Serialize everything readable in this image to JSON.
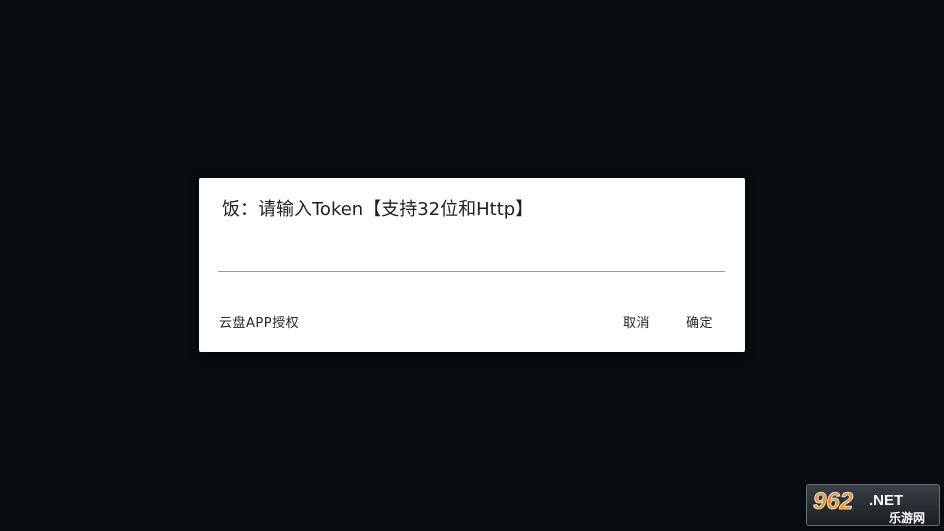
{
  "dialog": {
    "title": "饭：请输入Token【支持32位和Http】",
    "input": {
      "value": "",
      "placeholder": ""
    },
    "buttons": {
      "auth_label": "云盘APP授权",
      "cancel_label": "取消",
      "ok_label": "确定"
    }
  },
  "watermark": {
    "logo_text": "962.NET",
    "sub_text": "乐游网"
  },
  "colors": {
    "background": "#080b10",
    "dialog_bg": "#ffffff",
    "underline": "#9a9a9a",
    "watermark_orange": "#f28a1d"
  }
}
